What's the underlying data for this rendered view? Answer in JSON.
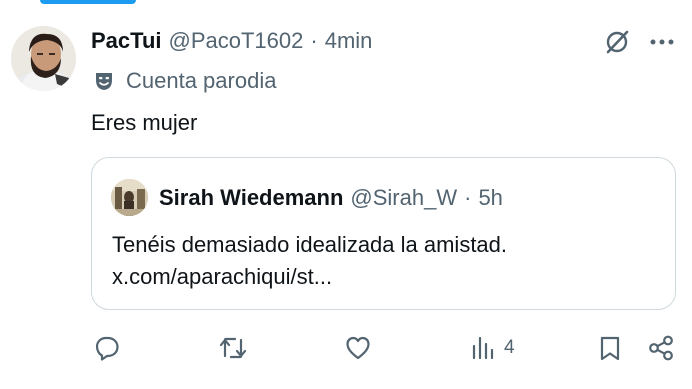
{
  "post": {
    "display_name": "PacTui",
    "handle": "@PacoT1602",
    "separator": "·",
    "time": "4min",
    "parody_label": "Cuenta parodia",
    "text": "Eres mujer"
  },
  "quote": {
    "display_name": "Sirah Wiedemann",
    "handle": "@Sirah_W",
    "separator": "·",
    "time": "5h",
    "line1": "Tenéis demasiado idealizada la amistad.",
    "line2": "x.com/aparachiqui/st..."
  },
  "actions": {
    "views_count": "4"
  },
  "icons": {
    "grok": "grok-icon",
    "more": "more-icon",
    "parody": "theater-mask-icon",
    "reply": "reply-icon",
    "repost": "repost-icon",
    "like": "heart-icon",
    "views": "views-icon",
    "bookmark": "bookmark-icon",
    "share": "share-icon"
  },
  "colors": {
    "text_primary": "#0f1419",
    "text_secondary": "#536471",
    "border": "#cfd9de",
    "accent": "#1d9bf0"
  }
}
